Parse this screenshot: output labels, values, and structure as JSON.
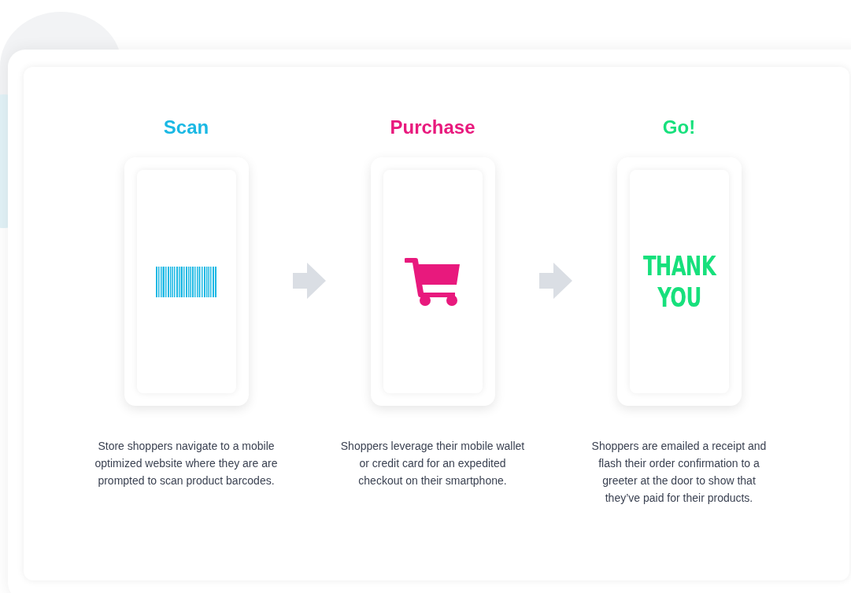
{
  "steps": [
    {
      "title": "Scan",
      "color": "#1ab8e4",
      "screen": {
        "kind": "barcode"
      },
      "description": "Store shoppers navigate to a mobile optimized website where they are are prompted to scan product barcodes."
    },
    {
      "title": "Purchase",
      "color": "#e8197d",
      "screen": {
        "kind": "cart"
      },
      "description": "Shoppers leverage their mobile wallet or credit card for an expedited checkout on their smartphone."
    },
    {
      "title": "Go!",
      "color": "#17e07c",
      "screen": {
        "kind": "text",
        "lines": [
          "THANK",
          "YOU"
        ]
      },
      "description": "Shoppers are emailed a receipt and flash their order confirmation to a greeter at the door to show that they’ve paid for their products."
    }
  ]
}
